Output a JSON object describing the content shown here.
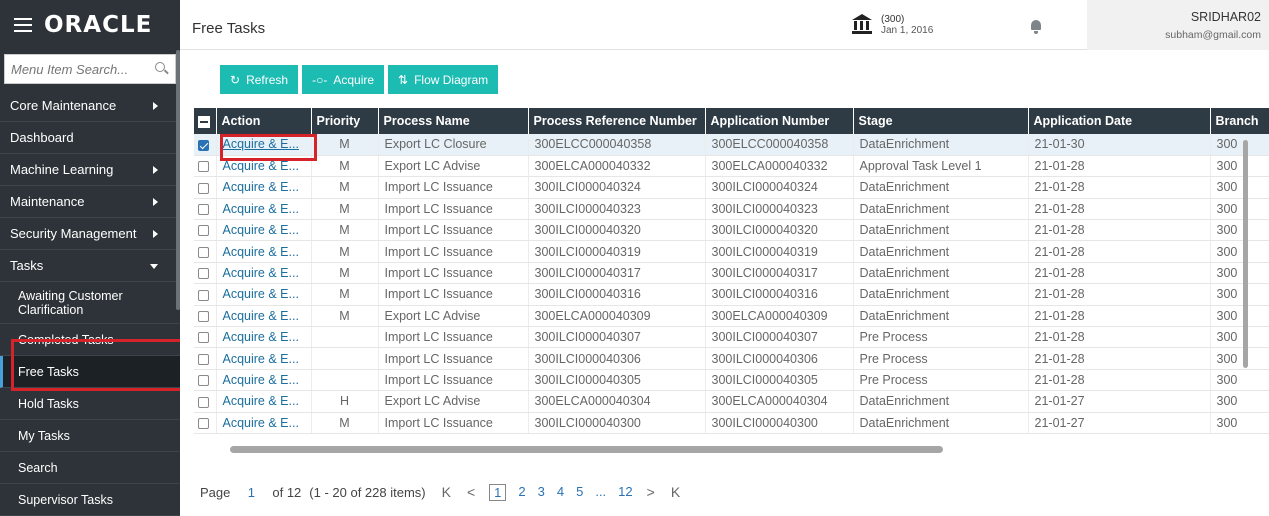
{
  "sidebar": {
    "logo": "ORACLE",
    "search_placeholder": "Menu Item Search...",
    "items": [
      {
        "label": "Core Maintenance",
        "arrow": "right"
      },
      {
        "label": "Dashboard",
        "arrow": ""
      },
      {
        "label": "Machine Learning",
        "arrow": "right"
      },
      {
        "label": "Maintenance",
        "arrow": "right"
      },
      {
        "label": "Security Management",
        "arrow": "right"
      },
      {
        "label": "Tasks",
        "arrow": "down"
      }
    ],
    "subitems": [
      {
        "label": "Awaiting Customer Clarification",
        "active": false
      },
      {
        "label": "Completed Tasks",
        "active": false
      },
      {
        "label": "Free Tasks",
        "active": true
      },
      {
        "label": "Hold Tasks",
        "active": false
      },
      {
        "label": "My Tasks",
        "active": false
      },
      {
        "label": "Search",
        "active": false
      },
      {
        "label": "Supervisor Tasks",
        "active": false
      }
    ]
  },
  "header": {
    "title": "Free Tasks",
    "branch_code": "(300)",
    "branch_date": "Jan 1, 2016",
    "user_name": "SRIDHAR02",
    "user_email": "subham@gmail.com"
  },
  "toolbar": {
    "refresh": "Refresh",
    "acquire": "Acquire",
    "flow": "Flow Diagram"
  },
  "table": {
    "columns": [
      "Action",
      "Priority",
      "Process Name",
      "Process Reference Number",
      "Application Number",
      "Stage",
      "Application Date",
      "Branch"
    ],
    "rows": [
      {
        "checked": true,
        "action": "Acquire & E...",
        "priority": "M",
        "process": "Export LC Closure",
        "ref": "300ELCC000040358",
        "app": "300ELCC000040358",
        "stage": "DataEnrichment",
        "date": "21-01-30",
        "branch": "300"
      },
      {
        "checked": false,
        "action": "Acquire & E...",
        "priority": "M",
        "process": "Export LC Advise",
        "ref": "300ELCA000040332",
        "app": "300ELCA000040332",
        "stage": "Approval Task Level 1",
        "date": "21-01-28",
        "branch": "300"
      },
      {
        "checked": false,
        "action": "Acquire & E...",
        "priority": "M",
        "process": "Import LC Issuance",
        "ref": "300ILCI000040324",
        "app": "300ILCI000040324",
        "stage": "DataEnrichment",
        "date": "21-01-28",
        "branch": "300"
      },
      {
        "checked": false,
        "action": "Acquire & E...",
        "priority": "M",
        "process": "Import LC Issuance",
        "ref": "300ILCI000040323",
        "app": "300ILCI000040323",
        "stage": "DataEnrichment",
        "date": "21-01-28",
        "branch": "300"
      },
      {
        "checked": false,
        "action": "Acquire & E...",
        "priority": "M",
        "process": "Import LC Issuance",
        "ref": "300ILCI000040320",
        "app": "300ILCI000040320",
        "stage": "DataEnrichment",
        "date": "21-01-28",
        "branch": "300"
      },
      {
        "checked": false,
        "action": "Acquire & E...",
        "priority": "M",
        "process": "Import LC Issuance",
        "ref": "300ILCI000040319",
        "app": "300ILCI000040319",
        "stage": "DataEnrichment",
        "date": "21-01-28",
        "branch": "300"
      },
      {
        "checked": false,
        "action": "Acquire & E...",
        "priority": "M",
        "process": "Import LC Issuance",
        "ref": "300ILCI000040317",
        "app": "300ILCI000040317",
        "stage": "DataEnrichment",
        "date": "21-01-28",
        "branch": "300"
      },
      {
        "checked": false,
        "action": "Acquire & E...",
        "priority": "M",
        "process": "Import LC Issuance",
        "ref": "300ILCI000040316",
        "app": "300ILCI000040316",
        "stage": "DataEnrichment",
        "date": "21-01-28",
        "branch": "300"
      },
      {
        "checked": false,
        "action": "Acquire & E...",
        "priority": "M",
        "process": "Export LC Advise",
        "ref": "300ELCA000040309",
        "app": "300ELCA000040309",
        "stage": "DataEnrichment",
        "date": "21-01-28",
        "branch": "300"
      },
      {
        "checked": false,
        "action": "Acquire & E...",
        "priority": "",
        "process": "Import LC Issuance",
        "ref": "300ILCI000040307",
        "app": "300ILCI000040307",
        "stage": "Pre Process",
        "date": "21-01-28",
        "branch": "300"
      },
      {
        "checked": false,
        "action": "Acquire & E...",
        "priority": "",
        "process": "Import LC Issuance",
        "ref": "300ILCI000040306",
        "app": "300ILCI000040306",
        "stage": "Pre Process",
        "date": "21-01-28",
        "branch": "300"
      },
      {
        "checked": false,
        "action": "Acquire & E...",
        "priority": "",
        "process": "Import LC Issuance",
        "ref": "300ILCI000040305",
        "app": "300ILCI000040305",
        "stage": "Pre Process",
        "date": "21-01-28",
        "branch": "300"
      },
      {
        "checked": false,
        "action": "Acquire & E...",
        "priority": "H",
        "process": "Export LC Advise",
        "ref": "300ELCA000040304",
        "app": "300ELCA000040304",
        "stage": "DataEnrichment",
        "date": "21-01-27",
        "branch": "300"
      },
      {
        "checked": false,
        "action": "Acquire & E...",
        "priority": "M",
        "process": "Import LC Issuance",
        "ref": "300ILCI000040300",
        "app": "300ILCI000040300",
        "stage": "DataEnrichment",
        "date": "21-01-27",
        "branch": "300"
      }
    ]
  },
  "pager": {
    "page_label": "Page",
    "current": "1",
    "of_text": "of 12",
    "range_text": "(1 - 20 of 228 items)",
    "pages": [
      "1",
      "2",
      "3",
      "4",
      "5",
      "...",
      "12"
    ],
    "first": "K",
    "prev": "<",
    "next": ">",
    "last": "K"
  },
  "colors": {
    "accent": "#1cbcb3",
    "sidebar": "#2d3338",
    "highlight": "#d6232a",
    "header": "#2e3b45"
  }
}
